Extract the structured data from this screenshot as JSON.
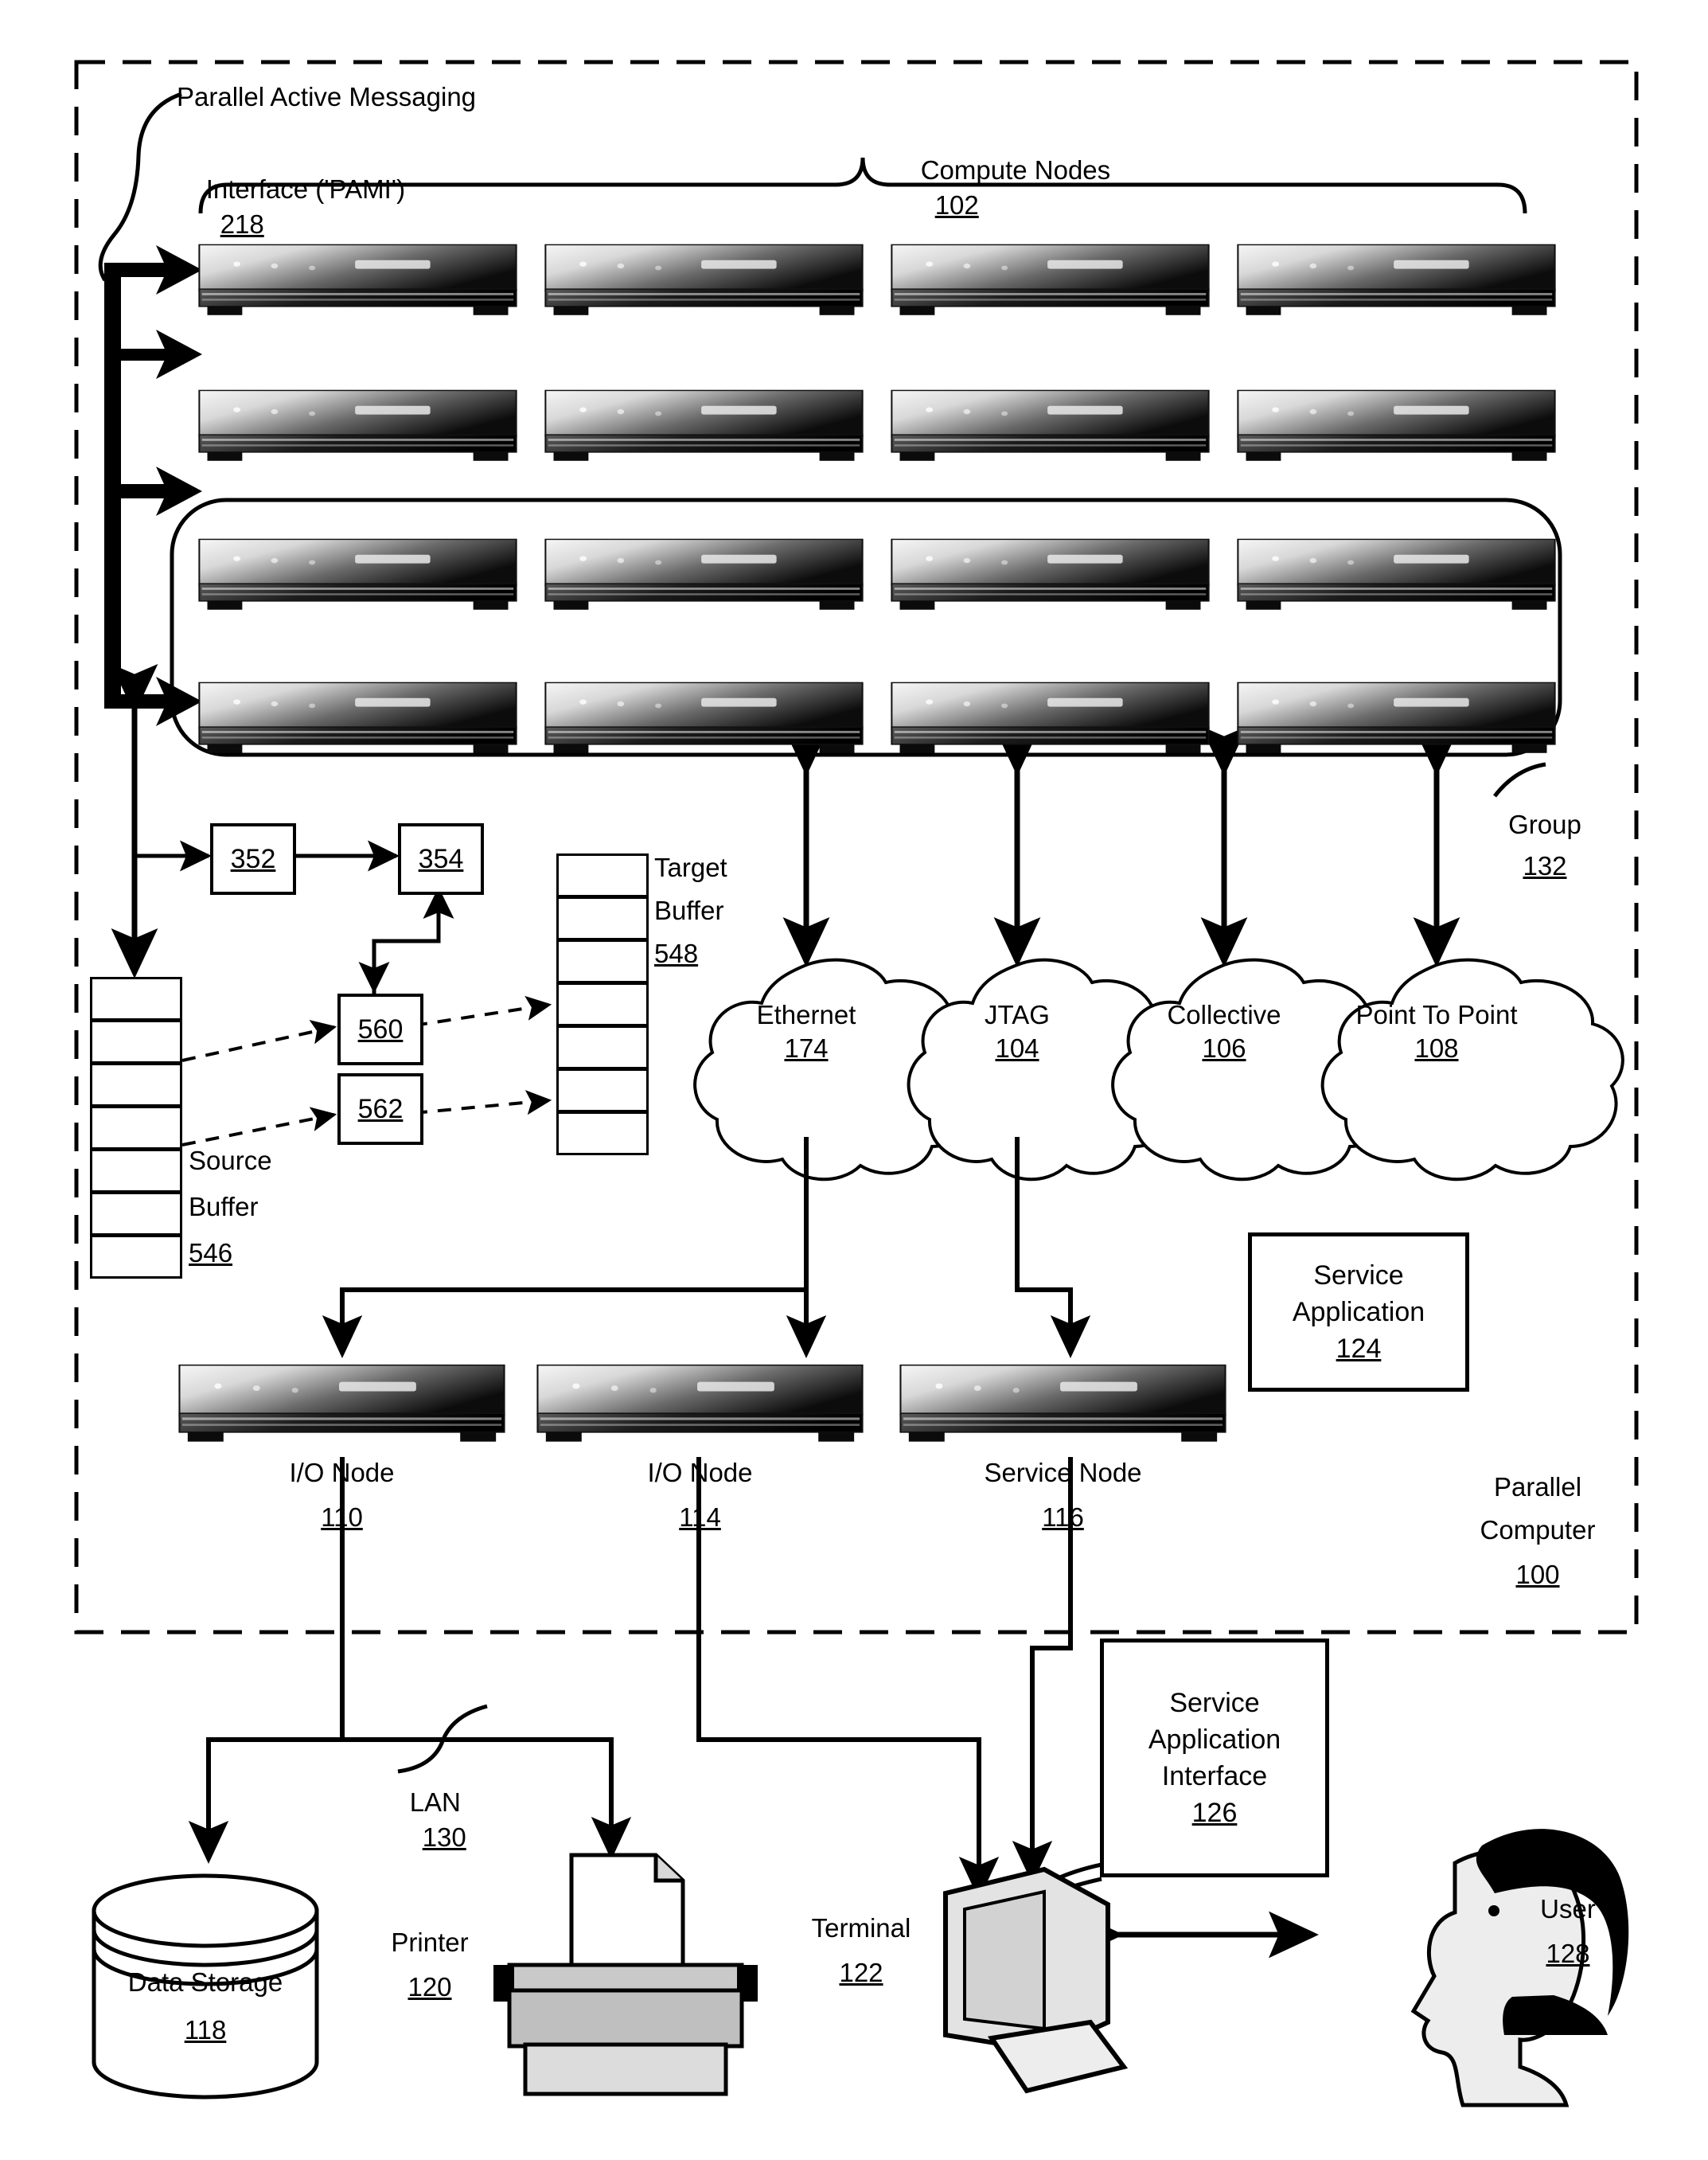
{
  "figure": {
    "outer_frame_label_line1": "Parallel",
    "outer_frame_label_line2": "Computer",
    "outer_frame_label_ref": "100"
  },
  "annotations": {
    "pami_line1": "Parallel Active Messaging",
    "pami_line2": "Interface ('PAMI')",
    "pami_ref": "218",
    "compute_nodes_label": "Compute Nodes",
    "compute_nodes_ref": "102",
    "group_label": "Group",
    "group_ref": "132",
    "lan_label": "LAN",
    "lan_ref": "130"
  },
  "context_boxes": [
    {
      "ref": "352"
    },
    {
      "ref": "354"
    },
    {
      "ref": "560"
    },
    {
      "ref": "562"
    }
  ],
  "buffers": {
    "source": {
      "line1": "Source",
      "line2": "Buffer",
      "ref": "546",
      "cells": 7
    },
    "target": {
      "line1": "Target",
      "line2": "Buffer",
      "ref": "548",
      "cells": 7
    }
  },
  "networks": [
    {
      "name": "Ethernet",
      "ref": "174"
    },
    {
      "name": "JTAG",
      "ref": "104"
    },
    {
      "name": "Collective",
      "ref": "106"
    },
    {
      "name": "Point To Point",
      "ref": "108"
    }
  ],
  "nodes": [
    {
      "label": "I/O Node",
      "ref": "110"
    },
    {
      "label": "I/O Node",
      "ref": "114"
    },
    {
      "label": "Service Node",
      "ref": "116"
    }
  ],
  "service_application": {
    "line1": "Service",
    "line2": "Application",
    "ref": "124"
  },
  "service_application_interface": {
    "line1": "Service",
    "line2": "Application",
    "line3": "Interface",
    "ref": "126"
  },
  "peripherals": [
    {
      "label": "Data Storage",
      "ref": "118",
      "icon": "cylinder-icon"
    },
    {
      "label": "Printer",
      "ref": "120",
      "icon": "printer-icon"
    },
    {
      "label": "Terminal",
      "ref": "122",
      "icon": "crt-computer-icon"
    },
    {
      "label": "User",
      "ref": "128",
      "icon": "person-head-icon"
    }
  ],
  "compute_node_grid": {
    "rows": 4,
    "columns": 4,
    "grouped_rows": [
      3,
      4
    ]
  },
  "colors": {
    "stroke": "#000000",
    "background": "#ffffff",
    "node_light": "#f2f2f2",
    "node_dark": "#0a0a0a",
    "shade": "#cfcfcf"
  }
}
